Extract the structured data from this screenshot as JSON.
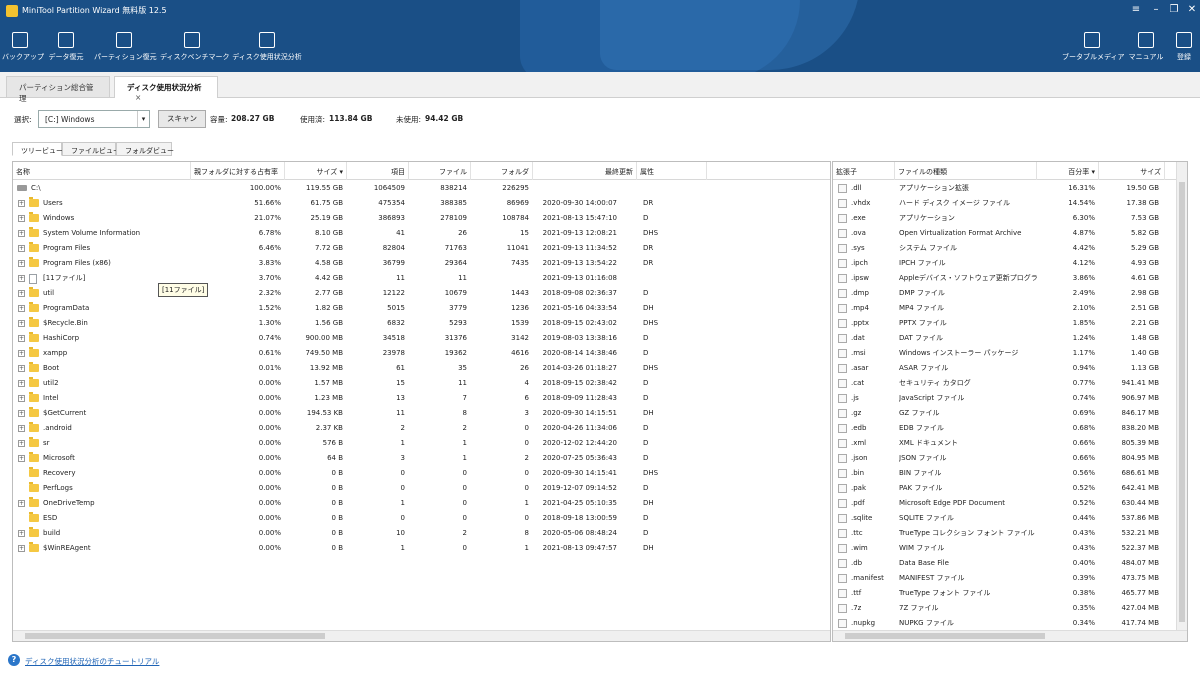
{
  "app": {
    "title": "MiniTool Partition Wizard 無料版 12.5",
    "accent": "#1a4f86"
  },
  "toolbar": {
    "left": [
      {
        "label": "バックアップ",
        "icon": "backup-icon"
      },
      {
        "label": "データ復元",
        "icon": "data-recovery-icon"
      },
      {
        "label": "パーティション復元",
        "icon": "partition-recovery-icon"
      },
      {
        "label": "ディスクベンチマーク",
        "icon": "disk-benchmark-icon"
      },
      {
        "label": "ディスク使用状況分析",
        "icon": "space-analyzer-icon"
      }
    ],
    "right": [
      {
        "label": "ブータブルメディア",
        "icon": "bootable-media-icon"
      },
      {
        "label": "マニュアル",
        "icon": "manual-icon"
      },
      {
        "label": "登録",
        "icon": "register-icon"
      }
    ]
  },
  "tabs": [
    {
      "label": "パーティション総合管理"
    },
    {
      "label": "ディスク使用状況分析",
      "close": "×"
    }
  ],
  "select": {
    "label": "選択:",
    "drive": "[C:] Windows",
    "scan": "スキャン",
    "capacity_label": "容量:",
    "capacity": "208.27 GB",
    "used_label": "使用済:",
    "used": "113.84 GB",
    "free_label": "未使用:",
    "free": "94.42 GB"
  },
  "view_tabs": [
    "ツリービュー",
    "ファイルビュー",
    "フォルダビュー"
  ],
  "tree": {
    "columns": [
      "名称",
      "親フォルダに対する占有率",
      "サイズ",
      "項目",
      "ファイル",
      "フォルダ",
      "最終更新",
      "属性"
    ],
    "rows": [
      {
        "name": "C:\\",
        "pct": "100.00%",
        "size": "119.55 GB",
        "items": "1064509",
        "files": "838214",
        "folders": "226295",
        "modified": "",
        "attr": "",
        "kind": "drive",
        "exp": false
      },
      {
        "name": "Users",
        "pct": "51.66%",
        "size": "61.75 GB",
        "items": "475354",
        "files": "388385",
        "folders": "86969",
        "modified": "2020-09-30 14:00:07",
        "attr": "DR",
        "kind": "folder",
        "exp": true
      },
      {
        "name": "Windows",
        "pct": "21.07%",
        "size": "25.19 GB",
        "items": "386893",
        "files": "278109",
        "folders": "108784",
        "modified": "2021-08-13 15:47:10",
        "attr": "D",
        "kind": "folder",
        "exp": true
      },
      {
        "name": "System Volume Information",
        "pct": "6.78%",
        "size": "8.10 GB",
        "items": "41",
        "files": "26",
        "folders": "15",
        "modified": "2021-09-13 12:08:21",
        "attr": "DHS",
        "kind": "folder",
        "exp": true
      },
      {
        "name": "Program Files",
        "pct": "6.46%",
        "size": "7.72 GB",
        "items": "82804",
        "files": "71763",
        "folders": "11041",
        "modified": "2021-09-13 11:34:52",
        "attr": "DR",
        "kind": "folder",
        "exp": true
      },
      {
        "name": "Program Files (x86)",
        "pct": "3.83%",
        "size": "4.58 GB",
        "items": "36799",
        "files": "29364",
        "folders": "7435",
        "modified": "2021-09-13 13:54:22",
        "attr": "DR",
        "kind": "folder",
        "exp": true
      },
      {
        "name": "[11ファイル]",
        "pct": "3.70%",
        "size": "4.42 GB",
        "items": "11",
        "files": "11",
        "folders": "",
        "modified": "2021-09-13 01:16:08",
        "attr": "",
        "kind": "file",
        "exp": true
      },
      {
        "name": "util",
        "pct": "2.32%",
        "size": "2.77 GB",
        "items": "12122",
        "files": "10679",
        "folders": "1443",
        "modified": "2018-09-08 02:36:37",
        "attr": "D",
        "kind": "folder",
        "exp": true
      },
      {
        "name": "ProgramData",
        "pct": "1.52%",
        "size": "1.82 GB",
        "items": "5015",
        "files": "3779",
        "folders": "1236",
        "modified": "2021-05-16 04:33:54",
        "attr": "DH",
        "kind": "folder",
        "exp": true
      },
      {
        "name": "$Recycle.Bin",
        "pct": "1.30%",
        "size": "1.56 GB",
        "items": "6832",
        "files": "5293",
        "folders": "1539",
        "modified": "2018-09-15 02:43:02",
        "attr": "DHS",
        "kind": "folder",
        "exp": true
      },
      {
        "name": "HashiCorp",
        "pct": "0.74%",
        "size": "900.00 MB",
        "items": "34518",
        "files": "31376",
        "folders": "3142",
        "modified": "2019-08-03 13:38:16",
        "attr": "D",
        "kind": "folder",
        "exp": true
      },
      {
        "name": "xampp",
        "pct": "0.61%",
        "size": "749.50 MB",
        "items": "23978",
        "files": "19362",
        "folders": "4616",
        "modified": "2020-08-14 14:38:46",
        "attr": "D",
        "kind": "folder",
        "exp": true
      },
      {
        "name": "Boot",
        "pct": "0.01%",
        "size": "13.92 MB",
        "items": "61",
        "files": "35",
        "folders": "26",
        "modified": "2014-03-26 01:18:27",
        "attr": "DHS",
        "kind": "folder",
        "exp": true
      },
      {
        "name": "util2",
        "pct": "0.00%",
        "size": "1.57 MB",
        "items": "15",
        "files": "11",
        "folders": "4",
        "modified": "2018-09-15 02:38:42",
        "attr": "D",
        "kind": "folder",
        "exp": true
      },
      {
        "name": "Intel",
        "pct": "0.00%",
        "size": "1.23 MB",
        "items": "13",
        "files": "7",
        "folders": "6",
        "modified": "2018-09-09 11:28:43",
        "attr": "D",
        "kind": "folder",
        "exp": true
      },
      {
        "name": "$GetCurrent",
        "pct": "0.00%",
        "size": "194.53 KB",
        "items": "11",
        "files": "8",
        "folders": "3",
        "modified": "2020-09-30 14:15:51",
        "attr": "DH",
        "kind": "folder",
        "exp": true
      },
      {
        "name": ".android",
        "pct": "0.00%",
        "size": "2.37 KB",
        "items": "2",
        "files": "2",
        "folders": "0",
        "modified": "2020-04-26 11:34:06",
        "attr": "D",
        "kind": "folder",
        "exp": true
      },
      {
        "name": "sr",
        "pct": "0.00%",
        "size": "576 B",
        "items": "1",
        "files": "1",
        "folders": "0",
        "modified": "2020-12-02 12:44:20",
        "attr": "D",
        "kind": "folder",
        "exp": true
      },
      {
        "name": "Microsoft",
        "pct": "0.00%",
        "size": "64 B",
        "items": "3",
        "files": "1",
        "folders": "2",
        "modified": "2020-07-25 05:36:43",
        "attr": "D",
        "kind": "folder",
        "exp": true
      },
      {
        "name": "Recovery",
        "pct": "0.00%",
        "size": "0 B",
        "items": "0",
        "files": "0",
        "folders": "0",
        "modified": "2020-09-30 14:15:41",
        "attr": "DHS",
        "kind": "folder",
        "exp": false
      },
      {
        "name": "PerfLogs",
        "pct": "0.00%",
        "size": "0 B",
        "items": "0",
        "files": "0",
        "folders": "0",
        "modified": "2019-12-07 09:14:52",
        "attr": "D",
        "kind": "folder",
        "exp": false
      },
      {
        "name": "OneDriveTemp",
        "pct": "0.00%",
        "size": "0 B",
        "items": "1",
        "files": "0",
        "folders": "1",
        "modified": "2021-04-25 05:10:35",
        "attr": "DH",
        "kind": "folder",
        "exp": true
      },
      {
        "name": "ESD",
        "pct": "0.00%",
        "size": "0 B",
        "items": "0",
        "files": "0",
        "folders": "0",
        "modified": "2018-09-18 13:00:59",
        "attr": "D",
        "kind": "folder",
        "exp": false
      },
      {
        "name": "build",
        "pct": "0.00%",
        "size": "0 B",
        "items": "10",
        "files": "2",
        "folders": "8",
        "modified": "2020-05-06 08:48:24",
        "attr": "D",
        "kind": "folder",
        "exp": true
      },
      {
        "name": "$WinREAgent",
        "pct": "0.00%",
        "size": "0 B",
        "items": "1",
        "files": "0",
        "folders": "1",
        "modified": "2021-08-13 09:47:57",
        "attr": "DH",
        "kind": "folder",
        "exp": true
      }
    ],
    "tooltip": "[11ファイル]"
  },
  "ext": {
    "columns": [
      "拡張子",
      "ファイルの種類",
      "百分率",
      "サイズ"
    ],
    "rows": [
      {
        "ext": ".dll",
        "type": "アプリケーション拡張",
        "pct": "16.31%",
        "size": "19.50 GB"
      },
      {
        "ext": ".vhdx",
        "type": "ハード ディスク イメージ ファイル",
        "pct": "14.54%",
        "size": "17.38 GB"
      },
      {
        "ext": ".exe",
        "type": "アプリケーション",
        "pct": "6.30%",
        "size": "7.53 GB"
      },
      {
        "ext": ".ova",
        "type": "Open Virtualization Format Archive",
        "pct": "4.87%",
        "size": "5.82 GB"
      },
      {
        "ext": ".sys",
        "type": "システム ファイル",
        "pct": "4.42%",
        "size": "5.29 GB"
      },
      {
        "ext": ".ipch",
        "type": "IPCH ファイル",
        "pct": "4.12%",
        "size": "4.93 GB"
      },
      {
        "ext": ".ipsw",
        "type": "Appleデバイス・ソフトウェア更新プログラム",
        "pct": "3.86%",
        "size": "4.61 GB"
      },
      {
        "ext": ".dmp",
        "type": "DMP ファイル",
        "pct": "2.49%",
        "size": "2.98 GB"
      },
      {
        "ext": ".mp4",
        "type": "MP4 ファイル",
        "pct": "2.10%",
        "size": "2.51 GB"
      },
      {
        "ext": ".pptx",
        "type": "PPTX ファイル",
        "pct": "1.85%",
        "size": "2.21 GB"
      },
      {
        "ext": ".dat",
        "type": "DAT ファイル",
        "pct": "1.24%",
        "size": "1.48 GB"
      },
      {
        "ext": ".msi",
        "type": "Windows インストーラー パッケージ",
        "pct": "1.17%",
        "size": "1.40 GB"
      },
      {
        "ext": ".asar",
        "type": "ASAR ファイル",
        "pct": "0.94%",
        "size": "1.13 GB"
      },
      {
        "ext": ".cat",
        "type": "セキュリティ カタログ",
        "pct": "0.77%",
        "size": "941.41 MB"
      },
      {
        "ext": ".js",
        "type": "JavaScript ファイル",
        "pct": "0.74%",
        "size": "906.97 MB"
      },
      {
        "ext": ".gz",
        "type": "GZ ファイル",
        "pct": "0.69%",
        "size": "846.17 MB"
      },
      {
        "ext": ".edb",
        "type": "EDB ファイル",
        "pct": "0.68%",
        "size": "838.20 MB"
      },
      {
        "ext": ".xml",
        "type": "XML ドキュメント",
        "pct": "0.66%",
        "size": "805.39 MB"
      },
      {
        "ext": ".json",
        "type": "JSON ファイル",
        "pct": "0.66%",
        "size": "804.95 MB"
      },
      {
        "ext": ".bin",
        "type": "BIN ファイル",
        "pct": "0.56%",
        "size": "686.61 MB"
      },
      {
        "ext": ".pak",
        "type": "PAK ファイル",
        "pct": "0.52%",
        "size": "642.41 MB"
      },
      {
        "ext": ".pdf",
        "type": "Microsoft Edge PDF Document",
        "pct": "0.52%",
        "size": "630.44 MB"
      },
      {
        "ext": ".sqlite",
        "type": "SQLITE ファイル",
        "pct": "0.44%",
        "size": "537.86 MB"
      },
      {
        "ext": ".ttc",
        "type": "TrueType コレクション フォント ファイル",
        "pct": "0.43%",
        "size": "532.21 MB"
      },
      {
        "ext": ".wim",
        "type": "WIM ファイル",
        "pct": "0.43%",
        "size": "522.37 MB"
      },
      {
        "ext": ".db",
        "type": "Data Base File",
        "pct": "0.40%",
        "size": "484.07 MB"
      },
      {
        "ext": ".manifest",
        "type": "MANIFEST ファイル",
        "pct": "0.39%",
        "size": "473.75 MB"
      },
      {
        "ext": ".ttf",
        "type": "TrueType フォント ファイル",
        "pct": "0.38%",
        "size": "465.77 MB"
      },
      {
        "ext": ".7z",
        "type": "7Z ファイル",
        "pct": "0.35%",
        "size": "427.04 MB"
      },
      {
        "ext": ".nupkg",
        "type": "NUPKG ファイル",
        "pct": "0.34%",
        "size": "417.74 MB"
      }
    ]
  },
  "footer": {
    "help_link": "ディスク使用状況分析のチュートリアル"
  }
}
